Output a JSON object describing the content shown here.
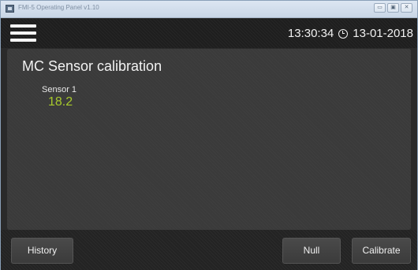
{
  "window": {
    "title": "FMI-5 Operating Panel v1.10",
    "buttons": {
      "minimize": "▭",
      "maximize": "▣",
      "close": "✕"
    }
  },
  "header": {
    "time": "13:30:34",
    "date": "13-01-2018",
    "icons": {
      "menu": "hamburger-menu-icon",
      "clock": "clock-icon"
    }
  },
  "main": {
    "title": "MC Sensor calibration",
    "sensor": {
      "label": "Sensor 1",
      "value": "18.2"
    }
  },
  "footer": {
    "history_label": "History",
    "null_label": "Null",
    "calibrate_label": "Calibrate"
  },
  "colors": {
    "accent_value": "#a7c92c",
    "panel_bg": "#3a3a3a",
    "header_bg": "#1e1e1e"
  }
}
